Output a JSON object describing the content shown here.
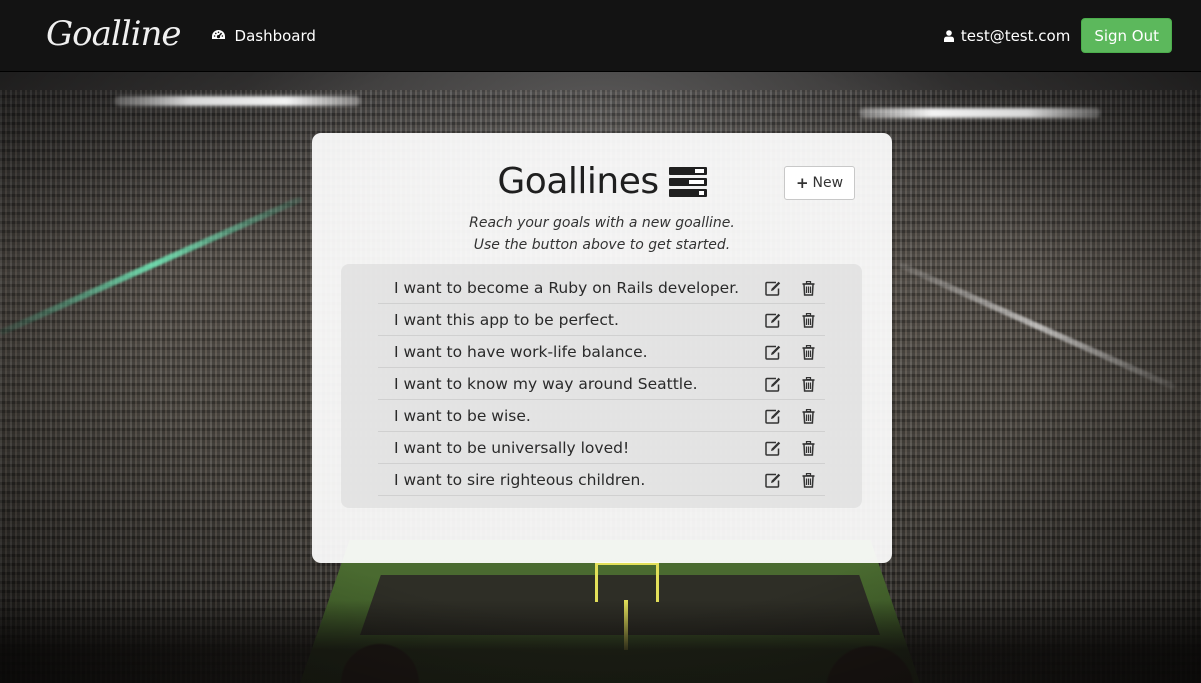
{
  "navbar": {
    "brand": "Goalline",
    "dashboard_label": "Dashboard",
    "user_email": "test@test.com",
    "signout_label": "Sign Out"
  },
  "panel": {
    "title": "Goallines",
    "new_label": "New",
    "subtitle_line1": "Reach your goals with a new goalline.",
    "subtitle_line2": "Use the button above to get started."
  },
  "goals": [
    {
      "text": "I want to become a Ruby on Rails developer."
    },
    {
      "text": "I want this app to be perfect."
    },
    {
      "text": "I want to have work-life balance."
    },
    {
      "text": "I want to know my way around Seattle."
    },
    {
      "text": "I want to be wise."
    },
    {
      "text": "I want to be universally loved!"
    },
    {
      "text": "I want to sire righteous children."
    }
  ],
  "icons": {
    "dashboard": "dashboard-gauge-icon",
    "user": "user-icon",
    "title": "tasks-list-icon",
    "new": "plus-icon",
    "edit": "edit-icon",
    "delete": "trash-icon"
  },
  "colors": {
    "navbar_bg": "#131313",
    "signout_green": "#5cb85c",
    "panel_bg": "#ffffff"
  }
}
